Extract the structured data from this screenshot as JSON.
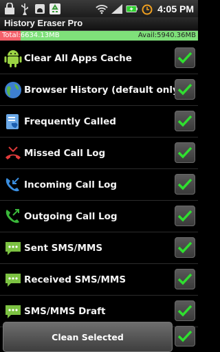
{
  "status_bar": {
    "time": "4:05",
    "time_suffix": "PM",
    "icons": [
      "lock-icon",
      "usb-icon",
      "android-debug-icon",
      "recycle-icon",
      "wifi-icon",
      "signal-icon",
      "battery-charging-icon",
      "alarm-icon"
    ]
  },
  "app": {
    "title": "History Eraser Pro"
  },
  "storage": {
    "total_label": "Total:6634.13MB",
    "avail_label": "Avail:5940.36MB",
    "used_fraction": 0.104,
    "used_color": "#f4606a",
    "free_color": "#7fe07a"
  },
  "items": [
    {
      "label": "Clear All Apps Cache",
      "icon": "android-robot-icon",
      "checked": true
    },
    {
      "label": "Browser History (default only)",
      "icon": "globe-icon",
      "checked": true
    },
    {
      "label": "Frequently Called",
      "icon": "phone-book-icon",
      "checked": true
    },
    {
      "label": "Missed Call Log",
      "icon": "missed-call-icon",
      "checked": true
    },
    {
      "label": "Incoming Call Log",
      "icon": "incoming-call-icon",
      "checked": true
    },
    {
      "label": "Outgoing Call Log",
      "icon": "outgoing-call-icon",
      "checked": true
    },
    {
      "label": "Sent SMS/MMS",
      "icon": "sms-icon",
      "checked": true
    },
    {
      "label": "Received SMS/MMS",
      "icon": "sms-icon",
      "checked": true
    },
    {
      "label": "SMS/MMS Draft",
      "icon": "sms-icon",
      "checked": true
    }
  ],
  "actions": {
    "clean_label": "Clean Selected",
    "select_all_checked": true
  },
  "colors": {
    "check_green": "#2fe02f",
    "background": "#000000"
  }
}
